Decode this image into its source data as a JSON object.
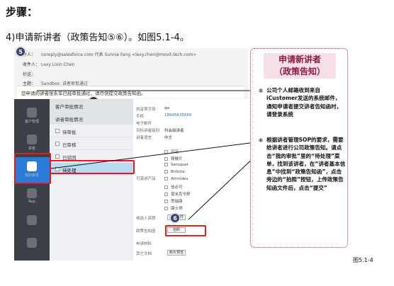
{
  "heading": "步骤：",
  "step": "4)申请新讲者（政策告知⑤⑥）。如图5.1-4。",
  "email": {
    "from_label": "件人：",
    "from": "noreply@salesforce.com 代表 Sunnie Fang <lexy.chen@movit-tech.com>",
    "to_label": "收件人：",
    "to": "Lexy Lixin Chen",
    "cc_label": "抄送：",
    "subject_label": "主题：",
    "subject": "Sandbox: 讲者审批通过",
    "body": "您申请的讲者张永军已经审批通过，请尽快提交政策告知函。"
  },
  "badges": {
    "five": "5",
    "six": "6"
  },
  "sidebar": {
    "items": [
      {
        "label": "客户管理"
      },
      {
        "label": "讲者"
      },
      {
        "label": "我的审批"
      },
      {
        "label": "Rep"
      }
    ]
  },
  "menu": {
    "section1": "客户审批情况",
    "section2": "讲者审批情况",
    "items": [
      "待审批",
      "已审核",
      "已驳回",
      "待处理"
    ]
  },
  "form": {
    "pinyin_label": "拼音首字母",
    "pinyin_value": "qa",
    "phone_label": "手机",
    "phone_value": "18045635666",
    "email_label": "电子邮件",
    "type_label": "目标讲者级别",
    "type_value": "科会级讲者",
    "lang_label": "讲者语言",
    "lang_value": "中文",
    "products_label": "可演讲产品",
    "products": [
      "可定",
      "顿楼片",
      "Seroquel",
      "Brilinta",
      "Arimidex",
      "信必可",
      "普米克令舒",
      "思瑞康",
      "康士得"
    ],
    "cand_label": "候选人资质",
    "policy_label": "政策告知函",
    "apply_label": "申请材料",
    "other_label": "其它文档",
    "btn_upload": "上传附件",
    "btn_photo": "拍照",
    "btn_attach": "新片预览"
  },
  "panel": {
    "title_line1": "申请新讲者",
    "title_line2": "（政策告知）",
    "n5": "⑤",
    "text5": "公司个人邮箱收到来自iCustomer发送的系统邮件，通知申请者提交讲者告知函时，请登录系统",
    "n6": "⑥",
    "text6": "根据讲者管理SOP的要求，需要给讲者进行公司政策告知。请点击“我的审批”里的“待处理”菜单，找到该讲者，在“讲者基本信息”中找到“政策告知函”，点击旁边的“拍照”按钮，上传政策告知函文件后，点击“提交”"
  },
  "figure_caption": "图5.1-4",
  "colors": {
    "red": "#e31b1b",
    "accent": "#2a7bd8",
    "panel_border": "#c2185b"
  }
}
